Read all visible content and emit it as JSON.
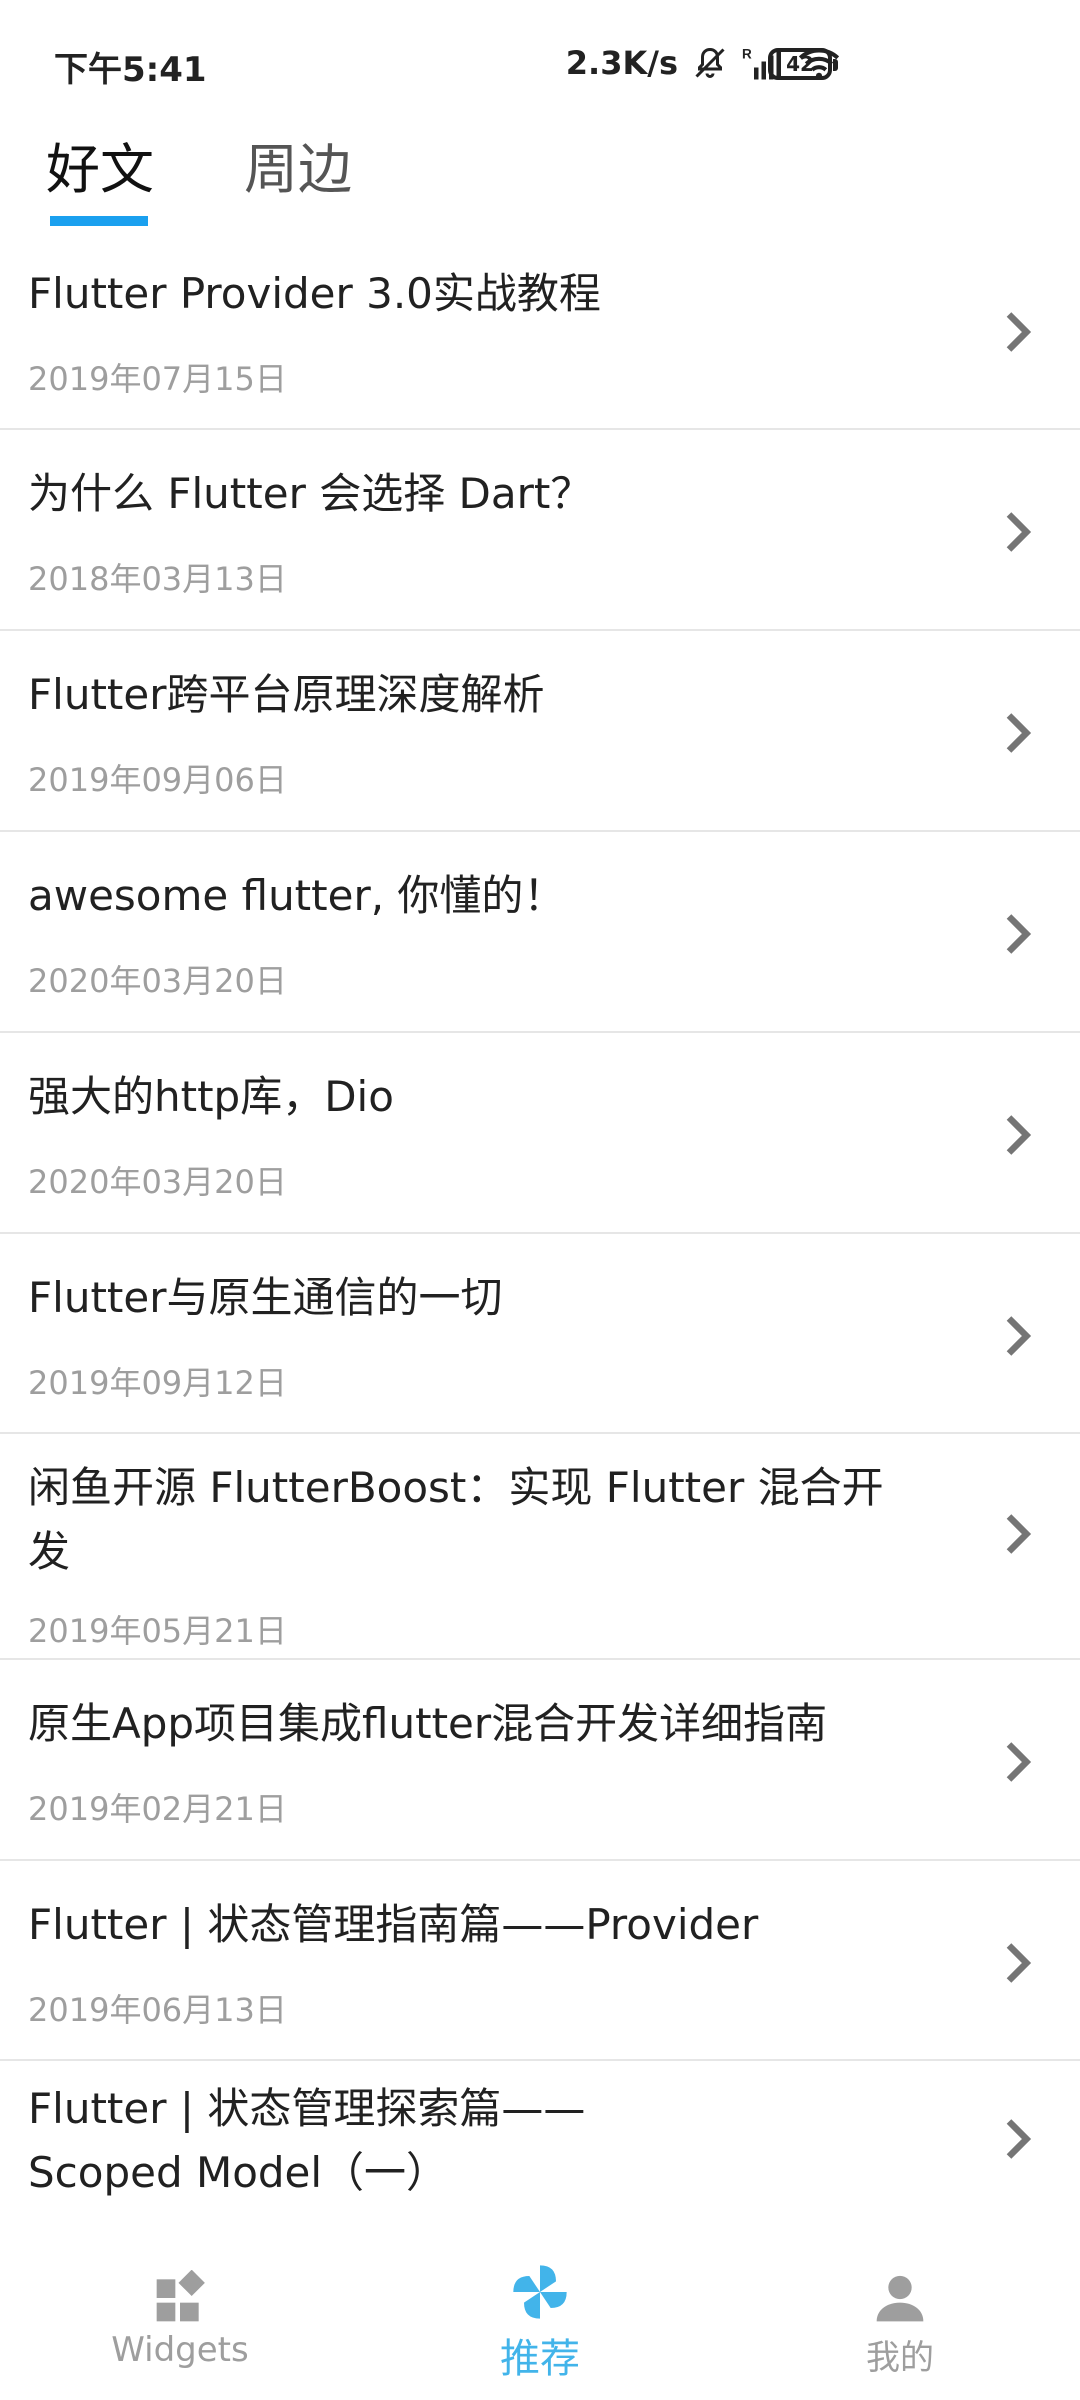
{
  "status_bar": {
    "time": "下午5:41",
    "network_speed": "2.3K/s",
    "battery": "42",
    "icons": [
      "mute-bell-icon",
      "signal-icon",
      "wifi-icon",
      "battery-icon"
    ]
  },
  "tabs": [
    {
      "label": "好文",
      "active": true
    },
    {
      "label": "周边",
      "active": false
    }
  ],
  "articles": [
    {
      "title": "Flutter Provider 3.0实战教程",
      "date": "2019年07月15日"
    },
    {
      "title": "为什么 Flutter 会选择 Dart？",
      "date": "2018年03月13日"
    },
    {
      "title": "Flutter跨平台原理深度解析",
      "date": "2019年09月06日"
    },
    {
      "title": "awesome flutter, 你懂的！",
      "date": "2020年03月20日"
    },
    {
      "title": "强大的http库，Dio",
      "date": "2020年03月20日"
    },
    {
      "title": "Flutter与原生通信的一切",
      "date": "2019年09月12日"
    },
    {
      "title": "闲鱼开源 FlutterBoost：实现 Flutter 混合开发",
      "date": "2019年05月21日"
    },
    {
      "title": "原生App项目集成flutter混合开发详细指南",
      "date": "2019年02月21日"
    },
    {
      "title": "Flutter | 状态管理指南篇——Provider",
      "date": "2019年06月13日"
    },
    {
      "title": "Flutter | 状态管理探索篇——Scoped Model（一）",
      "date": ""
    }
  ],
  "bottom_nav": [
    {
      "label": "Widgets",
      "icon": "widgets-icon",
      "active": false
    },
    {
      "label": "推荐",
      "icon": "pinwheel-icon",
      "active": true
    },
    {
      "label": "我的",
      "icon": "person-icon",
      "active": false
    }
  ],
  "colors": {
    "accent": "#1aa0ef",
    "nav_active": "#42b4ea",
    "text_secondary": "#9e9e9e",
    "divider": "#e6e6e6"
  }
}
